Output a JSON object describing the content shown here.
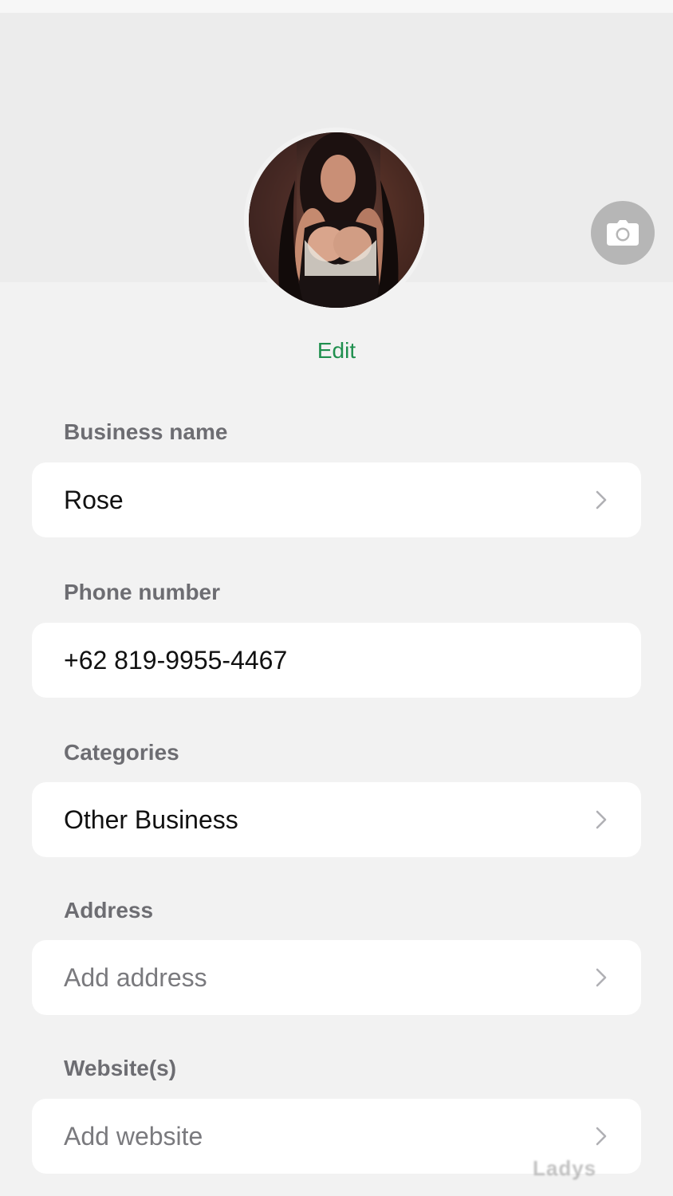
{
  "profile": {
    "edit_label": "Edit",
    "avatar_icon": "profile-photo",
    "camera_icon": "camera-icon"
  },
  "fields": [
    {
      "label": "Business name",
      "value": "Rose",
      "placeholder": false,
      "chevron": true
    },
    {
      "label": "Phone number",
      "value": "+62 819-9955-4467",
      "placeholder": false,
      "chevron": false
    },
    {
      "label": "Categories",
      "value": "Other Business",
      "placeholder": false,
      "chevron": true
    },
    {
      "label": "Address",
      "value": "Add address",
      "placeholder": true,
      "chevron": true
    },
    {
      "label": "Website(s)",
      "value": "Add website",
      "placeholder": true,
      "chevron": true
    }
  ],
  "watermark": "Ladys",
  "colors": {
    "accent": "#1f8f4e",
    "background": "#f2f2f2",
    "card": "#ffffff",
    "label": "#6d6d72"
  }
}
